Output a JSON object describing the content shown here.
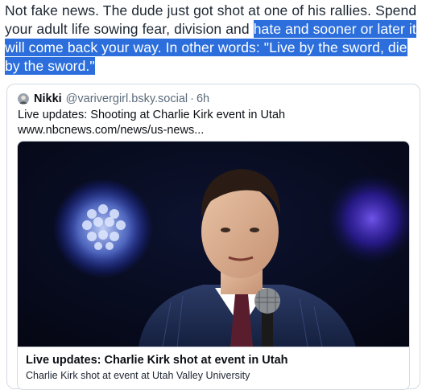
{
  "post": {
    "text_plain": "Not fake news. The dude just got shot at one of his rallies. Spend your adult life sowing fear, division and ",
    "text_highlighted": "hate and sooner or later it will come back your way. In other words: \"Live by the sword, die by the sword.\""
  },
  "quote": {
    "author_name": "Nikki",
    "author_handle": "@varivergirl.bsky.social",
    "separator": "·",
    "time": "6h",
    "line1": "Live updates: Shooting at Charlie Kirk event in Utah",
    "line2": "www.nbcnews.com/news/us-news..."
  },
  "link_card": {
    "title": "Live updates: Charlie Kirk shot at event in Utah",
    "description": "Charlie Kirk shot at event at Utah Valley University"
  },
  "colors": {
    "highlight": "#2c6fdc",
    "border": "#d4dbe2",
    "muted_text": "#5b6b7b"
  },
  "icons": {
    "avatar": "avatar-icon"
  }
}
